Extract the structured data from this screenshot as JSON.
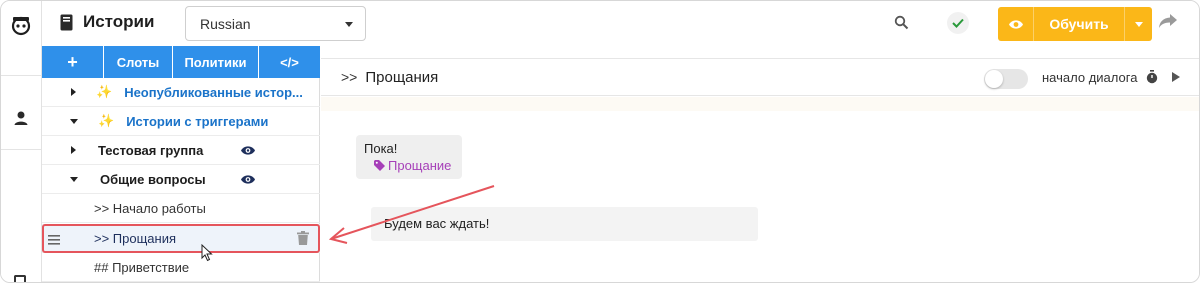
{
  "topbar": {
    "title": "Истории",
    "language": "Russian",
    "train_label": "Обучить"
  },
  "tree": {
    "toolbar": {
      "add_label": "+",
      "slots_label": "Слоты",
      "policies_label": "Политики",
      "code_label": "</>"
    },
    "items": [
      {
        "label": "Неопубликованные истор...",
        "kind": "group-special",
        "expanded": false
      },
      {
        "label": "Истории с триггерами",
        "kind": "group-special",
        "expanded": true
      },
      {
        "label": "Тестовая группа",
        "kind": "group",
        "expanded": false
      },
      {
        "label": "Общие вопросы",
        "kind": "group",
        "expanded": true
      },
      {
        "label": ">> Начало работы",
        "kind": "story"
      },
      {
        "label": ">> Прощания",
        "kind": "story",
        "selected": true
      },
      {
        "label": "## Приветствие",
        "kind": "story"
      }
    ]
  },
  "main": {
    "story_title": "Прощания",
    "toggle_label": "начало диалога",
    "user_message": "Пока!",
    "intent": "Прощание",
    "bot_message": "Будем вас ждать!"
  },
  "colors": {
    "accent_blue": "#2f90ea",
    "train_button": "#fbb718",
    "highlight_red": "#e5555c",
    "intent_purple": "#a63fb8"
  },
  "icons": [
    "logo-icon",
    "user-icon",
    "book-icon",
    "search-icon",
    "check-icon",
    "eye-icon",
    "share-icon",
    "sparkles-icon",
    "drag-handle-icon",
    "trash-icon",
    "timer-icon",
    "play-icon",
    "tag-icon",
    "cursor-icon"
  ]
}
